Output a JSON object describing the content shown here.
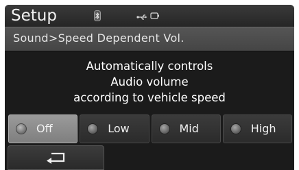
{
  "header": {
    "title": "Setup",
    "icons": [
      "bluetooth-icon",
      "usb-icon",
      "ipod-icon"
    ]
  },
  "breadcrumb": "Sound>Speed Dependent Vol.",
  "description": {
    "lines": [
      "Automatically controls",
      "Audio volume",
      "according to vehicle speed"
    ]
  },
  "options": [
    {
      "label": "Off",
      "selected": true
    },
    {
      "label": "Low",
      "selected": false
    },
    {
      "label": "Mid",
      "selected": false
    },
    {
      "label": "High",
      "selected": false
    }
  ],
  "back_button": {
    "icon": "return-arrow-icon"
  },
  "colors": {
    "screen_bg": "#1b1b1b",
    "selected_option": "#8c8c8c",
    "text": "#ffffff"
  }
}
